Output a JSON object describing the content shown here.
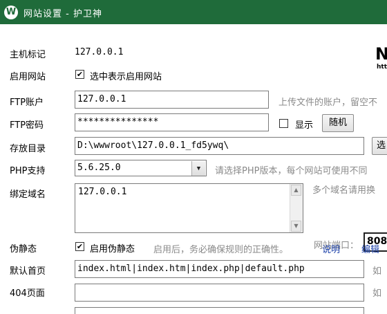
{
  "window": {
    "title": "网站设置 - 护卫神",
    "icon_letter": "W",
    "colors": {
      "titlebar": "#1f6b3a",
      "link": "#1a3fa8",
      "hint": "#8a8a8a"
    }
  },
  "form": {
    "host": {
      "label": "主机标记",
      "value": "127.0.0.1"
    },
    "enable_site": {
      "label": "启用网站",
      "checkbox_label": "选中表示启用网站",
      "checked": true
    },
    "ftp_account": {
      "label": "FTP账户",
      "value": "127.0.0.1",
      "hint": "上传文件的账户，留空不"
    },
    "ftp_password": {
      "label": "FTP密码",
      "value": "***************",
      "show_label": "显示",
      "show_checked": false,
      "random_button": "随机"
    },
    "storage_dir": {
      "label": "存放目录",
      "value": "D:\\wwwroot\\127.0.0.1_fd5ywq\\",
      "browse_button": "选"
    },
    "php": {
      "label": "PHP支持",
      "selected": "5.6.25.0",
      "hint": "请选择PHP版本，每个网站可使用不同"
    },
    "domains": {
      "label": "绑定域名",
      "value": "127.0.0.1",
      "hint": "多个域名请用换",
      "port_label": "网站端口：",
      "port_value": "808"
    },
    "rewrite": {
      "label": "伪静态",
      "checkbox_label": "启用伪静态",
      "checked": true,
      "hint": "启用后，务必确保规则的正确性。",
      "explain_link": "说明",
      "edit_link": "编辑"
    },
    "default_page": {
      "label": "默认首页",
      "value": "index.html|index.htm|index.php|default.php",
      "trailing": "如"
    },
    "page_404": {
      "label": "404页面",
      "value": "",
      "trailing": "如"
    }
  },
  "right_logo_text": {
    "big": "N",
    "small": "http"
  }
}
